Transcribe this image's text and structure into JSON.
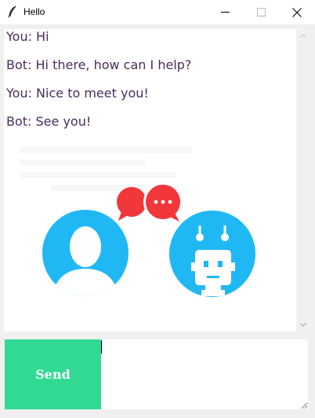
{
  "window": {
    "title": "Hello",
    "app_icon": "feather-icon",
    "controls": {
      "minimize_icon": "minimize-icon",
      "maximize_icon": "maximize-icon",
      "close_icon": "close-icon"
    }
  },
  "chat": {
    "messages": [
      {
        "text": "You: Hi"
      },
      {
        "text": "Bot: Hi there, how can I help?"
      },
      {
        "text": "You: Nice to meet you!"
      },
      {
        "text": "Bot: See you!"
      }
    ],
    "text_color": "#4a2c5e",
    "illustration": {
      "user_icon": "user-avatar-icon",
      "bot_icon": "robot-avatar-icon",
      "bubble_icon": "chat-bubbles-icon",
      "avatar_color": "#1fb8f5",
      "bubble_color": "#f2373a"
    }
  },
  "input": {
    "send_label": "Send",
    "value": "",
    "send_color": "#32d993"
  }
}
